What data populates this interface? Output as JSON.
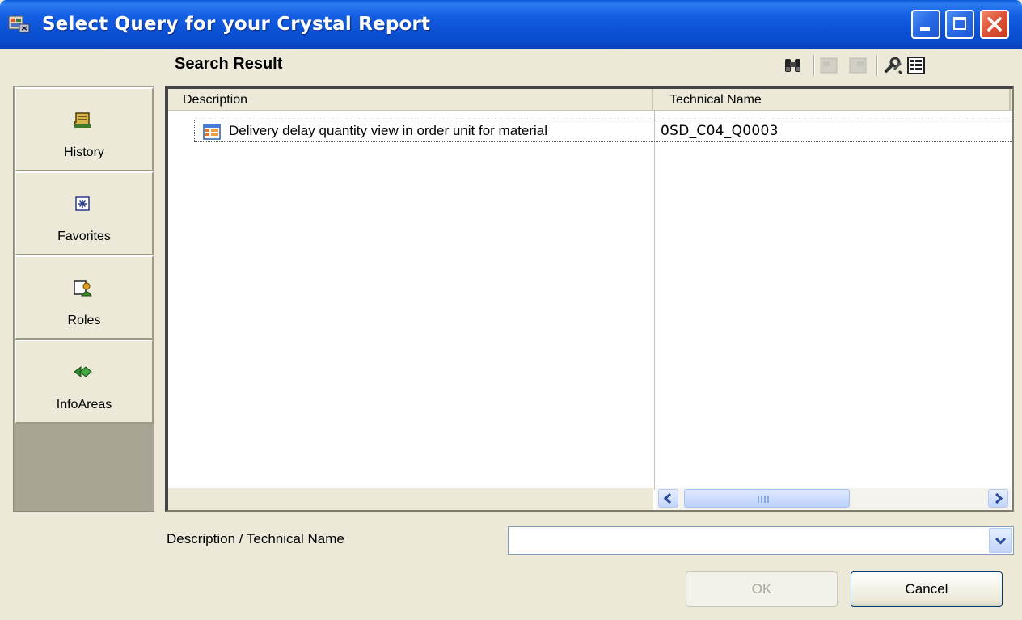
{
  "window": {
    "title": "Select Query for your Crystal Report",
    "title_bar_color": "#0a52d6",
    "close_button_color": "#e0553a"
  },
  "header": {
    "title": "Search Result",
    "toolbar_icons": [
      "binoculars-icon",
      "disabled-icon",
      "disabled-icon",
      "settings-tools-icon",
      "details-view-icon"
    ]
  },
  "nav": {
    "items": [
      {
        "label": "History",
        "icon": "history-scroll-icon"
      },
      {
        "label": "Favorites",
        "icon": "favorites-star-icon"
      },
      {
        "label": "Roles",
        "icon": "roles-icon"
      },
      {
        "label": "InfoAreas",
        "icon": "infoareas-diamond-icon"
      }
    ]
  },
  "results": {
    "columns": [
      "Description",
      "Technical Name"
    ],
    "rows": [
      {
        "description": "Delivery delay quantity view in order unit for material",
        "technical_name": "0SD_C04_Q0003",
        "icon": "query-table-icon"
      }
    ]
  },
  "search": {
    "label": "Description / Technical Name",
    "value": ""
  },
  "buttons": {
    "ok": "OK",
    "cancel": "Cancel"
  }
}
